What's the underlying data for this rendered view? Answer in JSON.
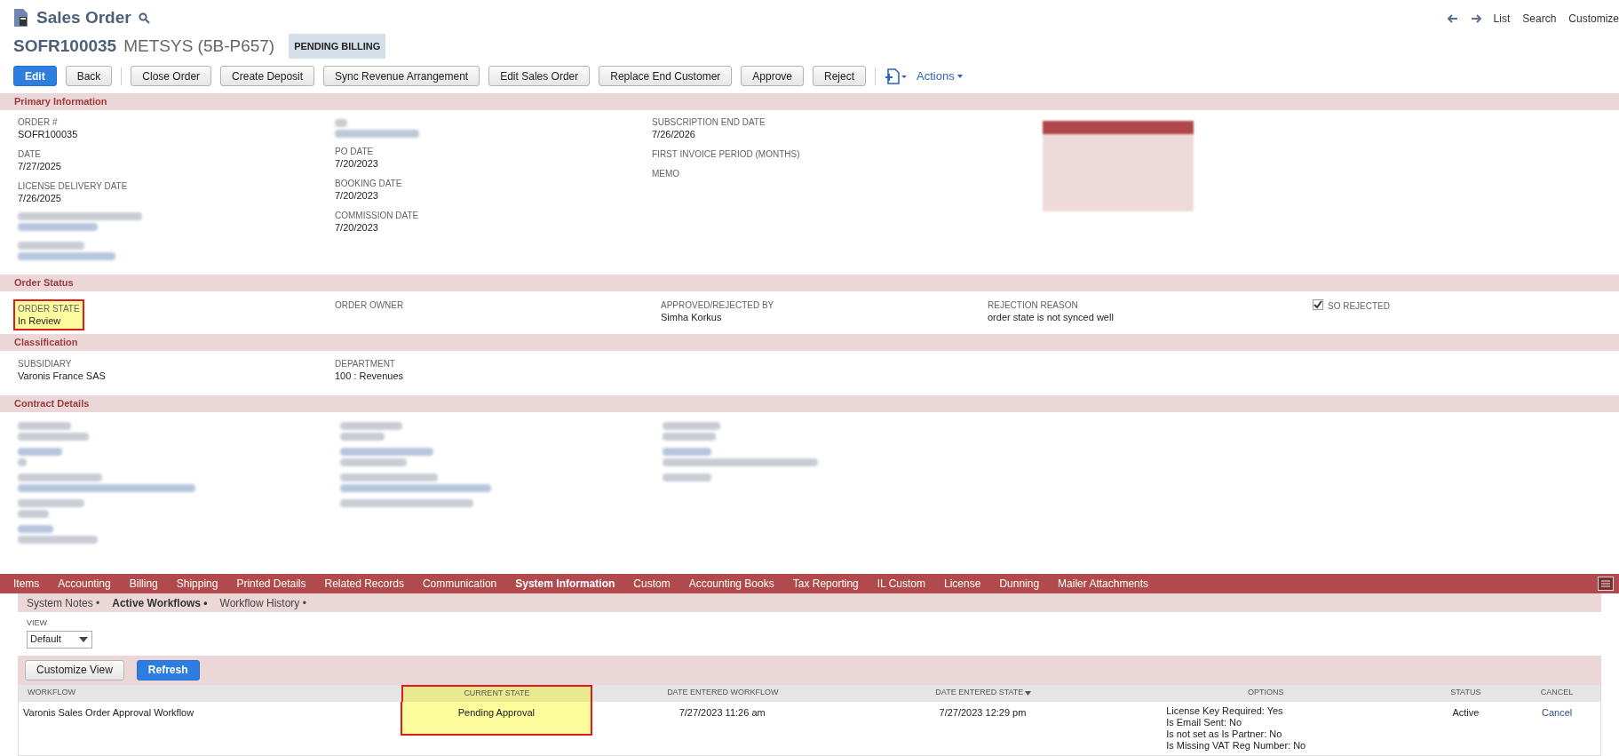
{
  "header": {
    "title": "Sales Order",
    "record_number": "SOFR100035",
    "entity": "METSYS (5B-P657)",
    "status_badge": "PENDING BILLING",
    "nav_links": [
      "List",
      "Search",
      "Customize"
    ]
  },
  "buttons": [
    {
      "label": "Edit",
      "primary": true
    },
    {
      "label": "Back",
      "primary": false
    },
    {
      "label": "Close Order",
      "primary": false
    },
    {
      "label": "Create Deposit",
      "primary": false
    },
    {
      "label": "Sync Revenue Arrangement",
      "primary": false
    },
    {
      "label": "Edit Sales Order",
      "primary": false
    },
    {
      "label": "Replace End Customer",
      "primary": false
    },
    {
      "label": "Approve",
      "primary": false
    },
    {
      "label": "Reject",
      "primary": false
    }
  ],
  "actions_menu": "Actions",
  "primary_information": {
    "title": "Primary Information",
    "columns": [
      [
        {
          "label": "ORDER #",
          "value": "SOFR100035"
        },
        {
          "label": "DATE",
          "value": "7/27/2025"
        },
        {
          "label": "LICENSE DELIVERY DATE",
          "value": "7/26/2025"
        }
      ],
      [
        {
          "label": "PO DATE",
          "value": "7/20/2023"
        },
        {
          "label": "BOOKING DATE",
          "value": "7/20/2023"
        },
        {
          "label": "COMMISSION DATE",
          "value": "7/20/2023"
        }
      ],
      [
        {
          "label": "SUBSCRIPTION END DATE",
          "value": "7/26/2026"
        },
        {
          "label": "FIRST INVOICE PERIOD (MONTHS)"
        },
        {
          "label": "MEMO"
        }
      ]
    ]
  },
  "order_status": {
    "title": "Order Status",
    "fields": [
      {
        "kind": "field",
        "label": "ORDER STATE",
        "value": "In Review",
        "highlighted": true
      },
      {
        "kind": "field",
        "label": "ORDER OWNER",
        "highlighted": false
      },
      {
        "kind": "field",
        "label": "APPROVED/REJECTED BY",
        "value": "Simha Korkus",
        "highlighted": false
      },
      {
        "kind": "field",
        "label": "REJECTION REASON",
        "value": "order state is not synced well",
        "highlighted": false
      },
      {
        "kind": "checkbox",
        "label": "SO REJECTED",
        "checked": true
      }
    ]
  },
  "classification": {
    "title": "Classification",
    "fields": [
      {
        "label": "SUBSIDIARY",
        "value": "Varonis France SAS"
      },
      {
        "label": "DEPARTMENT",
        "value": "100 : Revenues"
      }
    ]
  },
  "contract_details": {
    "title": "Contract Details"
  },
  "tabs": [
    {
      "label": "Items",
      "selected": false
    },
    {
      "label": "Accounting",
      "selected": false
    },
    {
      "label": "Billing",
      "selected": false
    },
    {
      "label": "Shipping",
      "selected": false
    },
    {
      "label": "Printed Details",
      "selected": false
    },
    {
      "label": "Related Records",
      "selected": false
    },
    {
      "label": "Communication",
      "selected": false
    },
    {
      "label": "System Information",
      "selected": true
    },
    {
      "label": "Custom",
      "selected": false
    },
    {
      "label": "Accounting Books",
      "selected": false
    },
    {
      "label": "Tax Reporting",
      "selected": false
    },
    {
      "label": "IL Custom",
      "selected": false
    },
    {
      "label": "License",
      "selected": false
    },
    {
      "label": "Dunning",
      "selected": false
    },
    {
      "label": "Mailer Attachments",
      "selected": false
    }
  ],
  "subtabs": [
    {
      "label": "System Notes •",
      "selected": false
    },
    {
      "label": "Active Workflows •",
      "selected": true
    },
    {
      "label": "Workflow History •",
      "selected": false
    }
  ],
  "view": {
    "label": "VIEW",
    "value": "Default"
  },
  "list_buttons": [
    {
      "label": "Customize View",
      "primary": false
    },
    {
      "label": "Refresh",
      "primary": true
    }
  ],
  "workflow_table": {
    "columns": [
      {
        "label": "WORKFLOW",
        "highlighted": false,
        "sorted": false
      },
      {
        "label": "CURRENT STATE",
        "highlighted": true,
        "sorted": false
      },
      {
        "label": "DATE ENTERED WORKFLOW",
        "highlighted": false,
        "sorted": false
      },
      {
        "label": "DATE ENTERED STATE",
        "highlighted": false,
        "sorted": true
      },
      {
        "label": "OPTIONS",
        "highlighted": false,
        "sorted": false
      },
      {
        "label": "STATUS",
        "highlighted": false,
        "sorted": false
      },
      {
        "label": "CANCEL",
        "highlighted": false,
        "sorted": false
      }
    ],
    "rows": [
      {
        "workflow": "Varonis Sales Order Approval Workflow",
        "current_state": "Pending Approval",
        "date_entered_workflow": "7/27/2023 11:26 am",
        "date_entered_state": "7/27/2023 12:29 pm",
        "options": [
          "License Key Required: Yes",
          "Is Email Sent: No",
          "Is not set as Is Partner: No",
          "Is Missing VAT Reg Number: No"
        ],
        "status": "Active",
        "cancel": "Cancel"
      }
    ]
  }
}
